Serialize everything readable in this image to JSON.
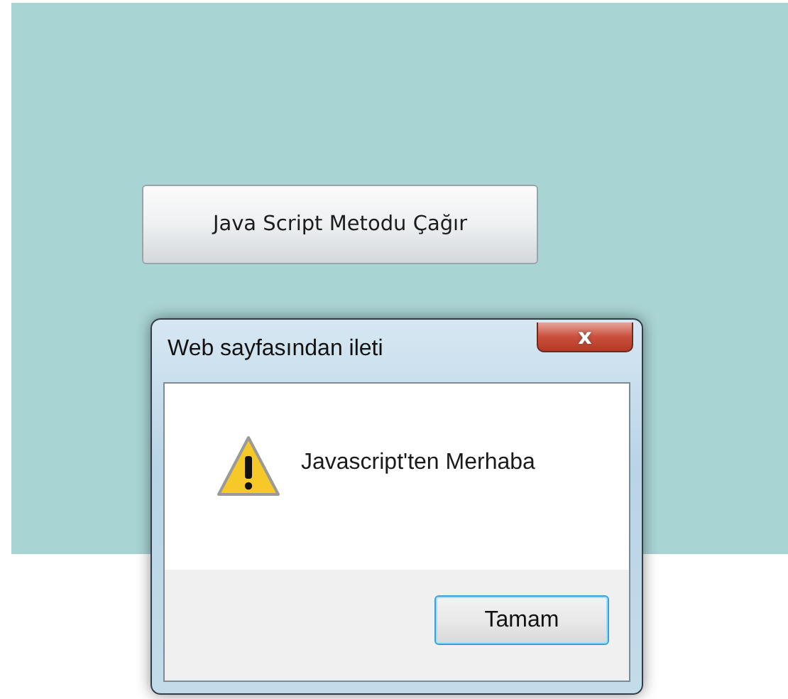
{
  "page": {
    "button": "Java Script Metodu Çağır"
  },
  "dialog": {
    "title": "Web sayfasından ileti",
    "close": "x",
    "message": "Javascript'ten Merhaba",
    "kind": "warning",
    "buttons": [
      "Tamam"
    ]
  }
}
